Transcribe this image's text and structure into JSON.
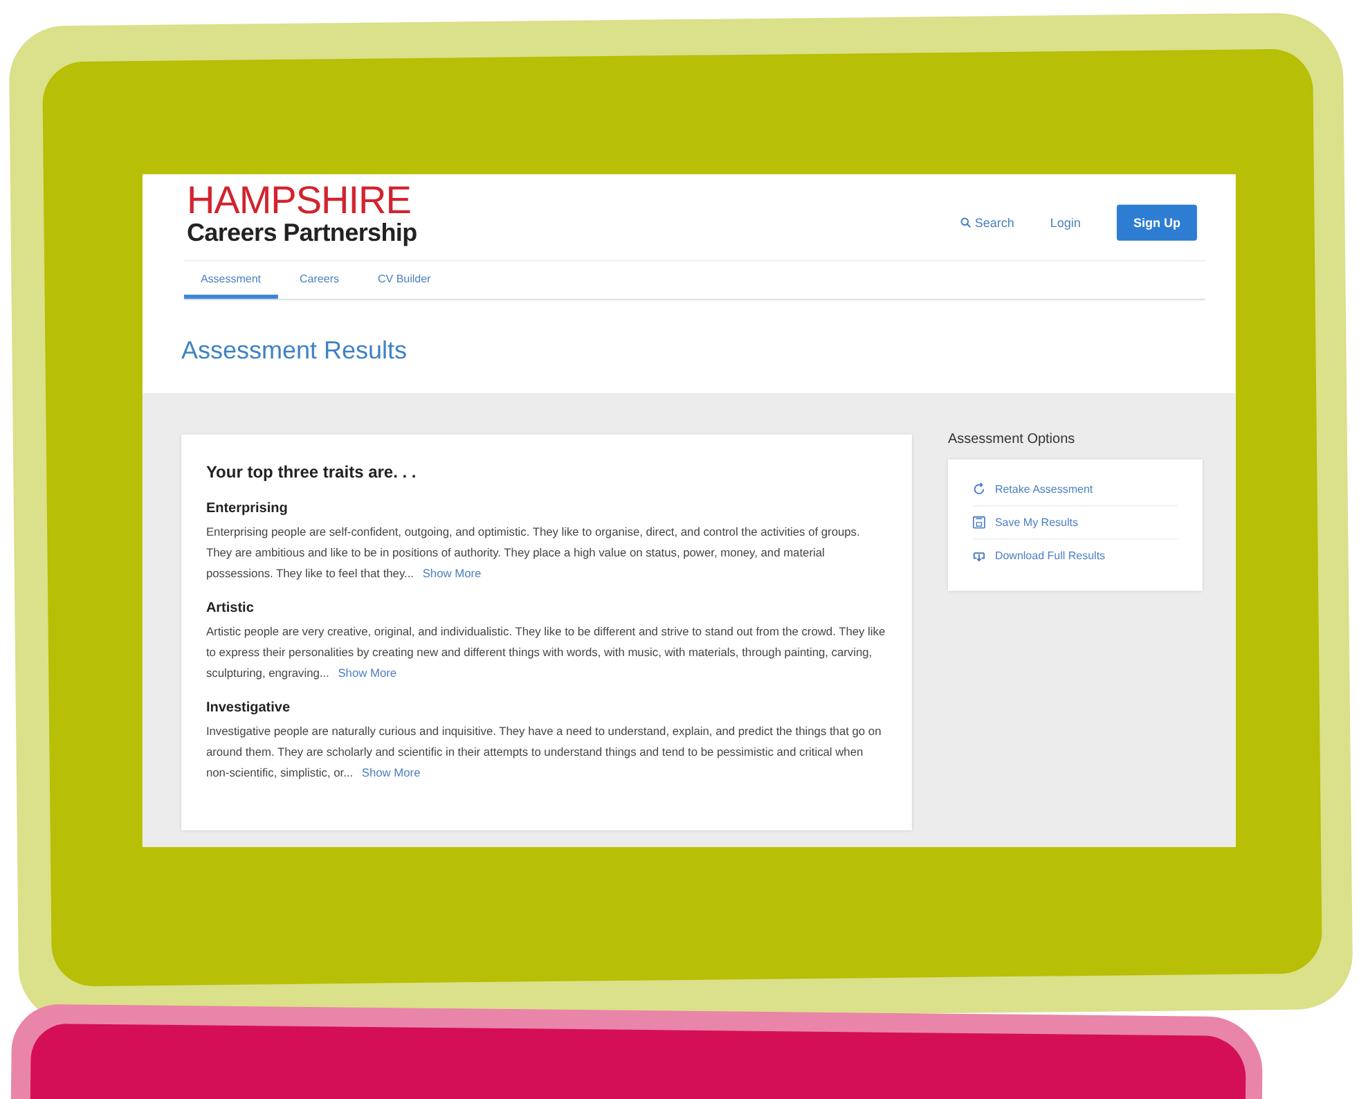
{
  "logo": {
    "title": "HAMPSHIRE",
    "subtitle": "Careers Partnership"
  },
  "header_actions": {
    "search": "Search",
    "login": "Login",
    "signup": "Sign Up"
  },
  "tabs": [
    {
      "label": "Assessment",
      "selected": true
    },
    {
      "label": "Careers",
      "selected": false
    },
    {
      "label": "CV Builder",
      "selected": false
    }
  ],
  "page_title": "Assessment Results",
  "results": {
    "heading": "Your top three traits are. . .",
    "traits": [
      {
        "name": "Enterprising",
        "description": "Enterprising people are self-confident, outgoing, and optimistic. They like to organise, direct, and control the activities of groups. They are ambitious and like to be in positions of authority. They place a high value on status, power, money, and material possessions. They like to feel that they...",
        "link": "Show More"
      },
      {
        "name": "Artistic",
        "description": "Artistic people are very creative, original, and individualistic. They like to be different and strive to stand out from the crowd. They like to express their personalities by creating new and different things with words, with music, with materials, through painting, carving, sculpturing, engraving...",
        "link": "Show More"
      },
      {
        "name": "Investigative",
        "description": "Investigative people are naturally curious and inquisitive. They have a need to understand, explain, and predict the things that go on around them. They are scholarly and scientific in their attempts to understand things and tend to be pessimistic and critical when non-scientific, simplistic, or...",
        "link": "Show More"
      }
    ]
  },
  "options": {
    "title": "Assessment Options",
    "items": [
      {
        "label": "Retake Assessment"
      },
      {
        "label": "Save My Results"
      },
      {
        "label": "Download Full Results"
      }
    ]
  }
}
